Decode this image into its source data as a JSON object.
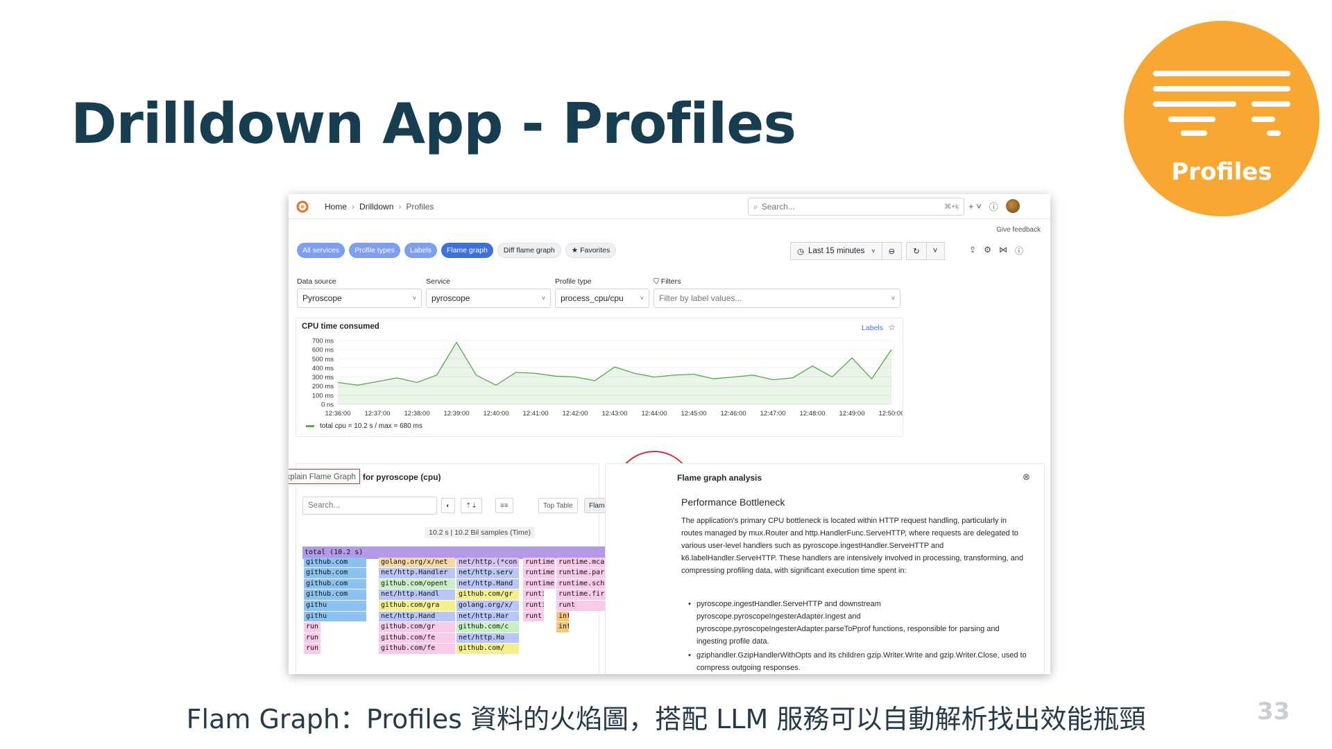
{
  "slide": {
    "title": "Drilldown App - Profiles",
    "badge_label": "Profiles",
    "caption": "Flam Graph：Profiles 資料的火焰圖，搭配 LLM 服務可以自動解析找出效能瓶頸",
    "page_number": "33"
  },
  "app": {
    "breadcrumbs": [
      "Home",
      "Drilldown",
      "Profiles"
    ],
    "search_placeholder": "Search...",
    "search_shortcut": "⌘+k",
    "give_feedback": "Give feedback",
    "pills": [
      {
        "label": "All services",
        "style": "blue"
      },
      {
        "label": "Profile types",
        "style": "blue"
      },
      {
        "label": "Labels",
        "style": "blue"
      },
      {
        "label": "Flame graph",
        "style": "dark"
      },
      {
        "label": "Diff flame graph",
        "style": "grey"
      },
      {
        "label": "★ Favorites",
        "style": "grey"
      }
    ],
    "time_range": "Last 15 minutes",
    "filters": {
      "data_source_label": "Data source",
      "data_source": "Pyroscope",
      "service_label": "Service",
      "service": "pyroscope",
      "profile_type_label": "Profile type",
      "profile_type": "process_cpu/cpu",
      "filters_label": "Filters",
      "filters_placeholder": "Filter by label values..."
    },
    "cpu_panel": {
      "title": "CPU time consumed",
      "labels_link": "Labels",
      "legend": "total cpu = 10.2 s / max = 680 ms"
    },
    "flame_panel": {
      "title": "Flame graph for pyroscope (cpu)",
      "explain_button": "Explain Flame Graph",
      "search_placeholder": "Search...",
      "view_top_table": "Top Table",
      "view_flame_graph": "Flame Graph",
      "samples": "10.2 s | 10.2 Bil samples (Time)",
      "root": "total (10.2 s)",
      "frames": [
        {
          "text": "github.com",
          "row": 1,
          "col": 0,
          "color": "#8cc2f2"
        },
        {
          "text": "golang.org/x/net",
          "row": 1,
          "col": 1,
          "color": "#f4d9a6"
        },
        {
          "text": "net/http.(*con",
          "row": 1,
          "col": 2,
          "color": "#d6c2f0"
        },
        {
          "text": "runtime",
          "row": 1,
          "col": 3,
          "color": "#f8c9e8"
        },
        {
          "text": "runtime.mcall (",
          "row": 1,
          "col": 4,
          "color": "#f8c9e8"
        },
        {
          "text": "github.com",
          "row": 2,
          "col": 0,
          "color": "#8cc2f2"
        },
        {
          "text": "net/http.Handler",
          "row": 2,
          "col": 1,
          "color": "#b9c6f7"
        },
        {
          "text": "net/http.serv",
          "row": 2,
          "col": 2,
          "color": "#b9c6f7"
        },
        {
          "text": "runtime",
          "row": 2,
          "col": 3,
          "color": "#f8c9e8"
        },
        {
          "text": "runtime.park_m",
          "row": 2,
          "col": 4,
          "color": "#f8c9e8"
        },
        {
          "text": "github.com",
          "row": 3,
          "col": 0,
          "color": "#8cc2f2"
        },
        {
          "text": "github.com/opent",
          "row": 3,
          "col": 1,
          "color": "#c9f0c2"
        },
        {
          "text": "net/http.Hand",
          "row": 3,
          "col": 2,
          "color": "#b9c6f7"
        },
        {
          "text": "runtime",
          "row": 3,
          "col": 3,
          "color": "#f8c9e8"
        },
        {
          "text": "runtime.schedu",
          "row": 3,
          "col": 4,
          "color": "#f8c9e8"
        },
        {
          "text": "github.com",
          "row": 4,
          "col": 0,
          "color": "#8cc2f2"
        },
        {
          "text": "net/http.Handl",
          "row": 4,
          "col": 1,
          "color": "#b9c6f7"
        },
        {
          "text": "github.com/gr",
          "row": 4,
          "col": 2,
          "color": "#f3f08d"
        },
        {
          "text": "runtir",
          "row": 4,
          "col": 3,
          "color": "#f8c9e8"
        },
        {
          "text": "runtime.fir",
          "row": 4,
          "col": 4,
          "color": "#f8c9e8"
        },
        {
          "text": "githu",
          "row": 5,
          "col": 0,
          "color": "#8cc2f2"
        },
        {
          "text": "github.com/gra",
          "row": 5,
          "col": 1,
          "color": "#f3f08d"
        },
        {
          "text": "golang.org/x/",
          "row": 5,
          "col": 2,
          "color": "#b9c6f7"
        },
        {
          "text": "runtir",
          "row": 5,
          "col": 3,
          "color": "#f8c9e8"
        },
        {
          "text": "runt",
          "row": 5,
          "col": 4,
          "color": "#f8c9e8"
        },
        {
          "text": "githu",
          "row": 6,
          "col": 0,
          "color": "#8cc2f2"
        },
        {
          "text": "net/http.Hand",
          "row": 6,
          "col": 1,
          "color": "#b9c6f7"
        },
        {
          "text": "net/http.Har",
          "row": 6,
          "col": 2,
          "color": "#b9c6f7"
        },
        {
          "text": "runt",
          "row": 6,
          "col": 3,
          "color": "#f8c9e8"
        },
        {
          "text": "int",
          "row": 6,
          "col": 4,
          "color": "#f6c77a"
        },
        {
          "text": "run",
          "row": 7,
          "col": 0,
          "color": "#f8c9e8"
        },
        {
          "text": "github.com/gr",
          "row": 7,
          "col": 1,
          "color": "#f8c9e8"
        },
        {
          "text": "github.com/c",
          "row": 7,
          "col": 2,
          "color": "#c9f0c2"
        },
        {
          "text": "int",
          "row": 7,
          "col": 4,
          "color": "#f6c77a"
        },
        {
          "text": "run",
          "row": 8,
          "col": 0,
          "color": "#f8c9e8"
        },
        {
          "text": "github.com/fe",
          "row": 8,
          "col": 1,
          "color": "#f8c9e8"
        },
        {
          "text": "net/http.Ha",
          "row": 8,
          "col": 2,
          "color": "#b9c6f7"
        },
        {
          "text": "run",
          "row": 9,
          "col": 0,
          "color": "#f8c9e8"
        },
        {
          "text": "github.com/fe",
          "row": 9,
          "col": 1,
          "color": "#f8c9e8"
        },
        {
          "text": "github.com/",
          "row": 9,
          "col": 2,
          "color": "#f3f08d"
        }
      ]
    },
    "analysis_panel": {
      "title": "Flame graph analysis",
      "heading": "Performance Bottleneck",
      "paragraph": "The application's primary CPU bottleneck is located within HTTP request handling, particularly in routes managed by mux.Router and http.HandlerFunc.ServeHTTP, where requests are delegated to various user-level handlers such as pyroscope.ingestHandler.ServeHTTP and k6.labelHandler.ServeHTTP. These handlers are intensively involved in processing, transforming, and compressing profiling data, with significant execution time spent in:",
      "bullets": [
        "pyroscope.ingestHandler.ServeHTTP and downstream pyroscope.pyroscopeIngesterAdapter.Ingest and pyroscope.pyroscopeIngesterAdapter.parseToPprof functions, responsible for parsing and ingesting profile data.",
        "gziphandler.GzipHandlerWithOpts and its children gzip.Writer.Write and gzip.Writer.Close, used to compress outgoing responses."
      ]
    }
  },
  "chart_data": {
    "type": "line",
    "title": "CPU time consumed",
    "x": [
      "12:36:00",
      "12:36:30",
      "12:37:00",
      "12:37:30",
      "12:38:00",
      "12:38:30",
      "12:39:00",
      "12:39:30",
      "12:40:00",
      "12:40:30",
      "12:41:00",
      "12:41:30",
      "12:42:00",
      "12:42:30",
      "12:43:00",
      "12:43:30",
      "12:44:00",
      "12:44:30",
      "12:45:00",
      "12:45:30",
      "12:46:00",
      "12:46:30",
      "12:47:00",
      "12:47:30",
      "12:48:00",
      "12:48:30",
      "12:49:00",
      "12:49:30",
      "12:50:00"
    ],
    "x_ticks": [
      "12:36:00",
      "12:37:00",
      "12:38:00",
      "12:39:00",
      "12:40:00",
      "12:41:00",
      "12:42:00",
      "12:43:00",
      "12:44:00",
      "12:45:00",
      "12:46:00",
      "12:47:00",
      "12:48:00",
      "12:49:00",
      "12:50:00"
    ],
    "series": [
      {
        "name": "total cpu",
        "color": "#56a64b",
        "values": [
          240,
          210,
          250,
          290,
          240,
          320,
          680,
          320,
          210,
          350,
          340,
          310,
          300,
          260,
          410,
          340,
          300,
          320,
          330,
          280,
          300,
          320,
          270,
          290,
          420,
          300,
          510,
          280,
          600
        ]
      }
    ],
    "y_ticks": [
      "0 ns",
      "100 ms",
      "200 ms",
      "300 ms",
      "400 ms",
      "500 ms",
      "600 ms",
      "700 ms"
    ],
    "ylim": [
      0,
      700
    ],
    "legend": "total cpu = 10.2 s / max = 680 ms"
  }
}
